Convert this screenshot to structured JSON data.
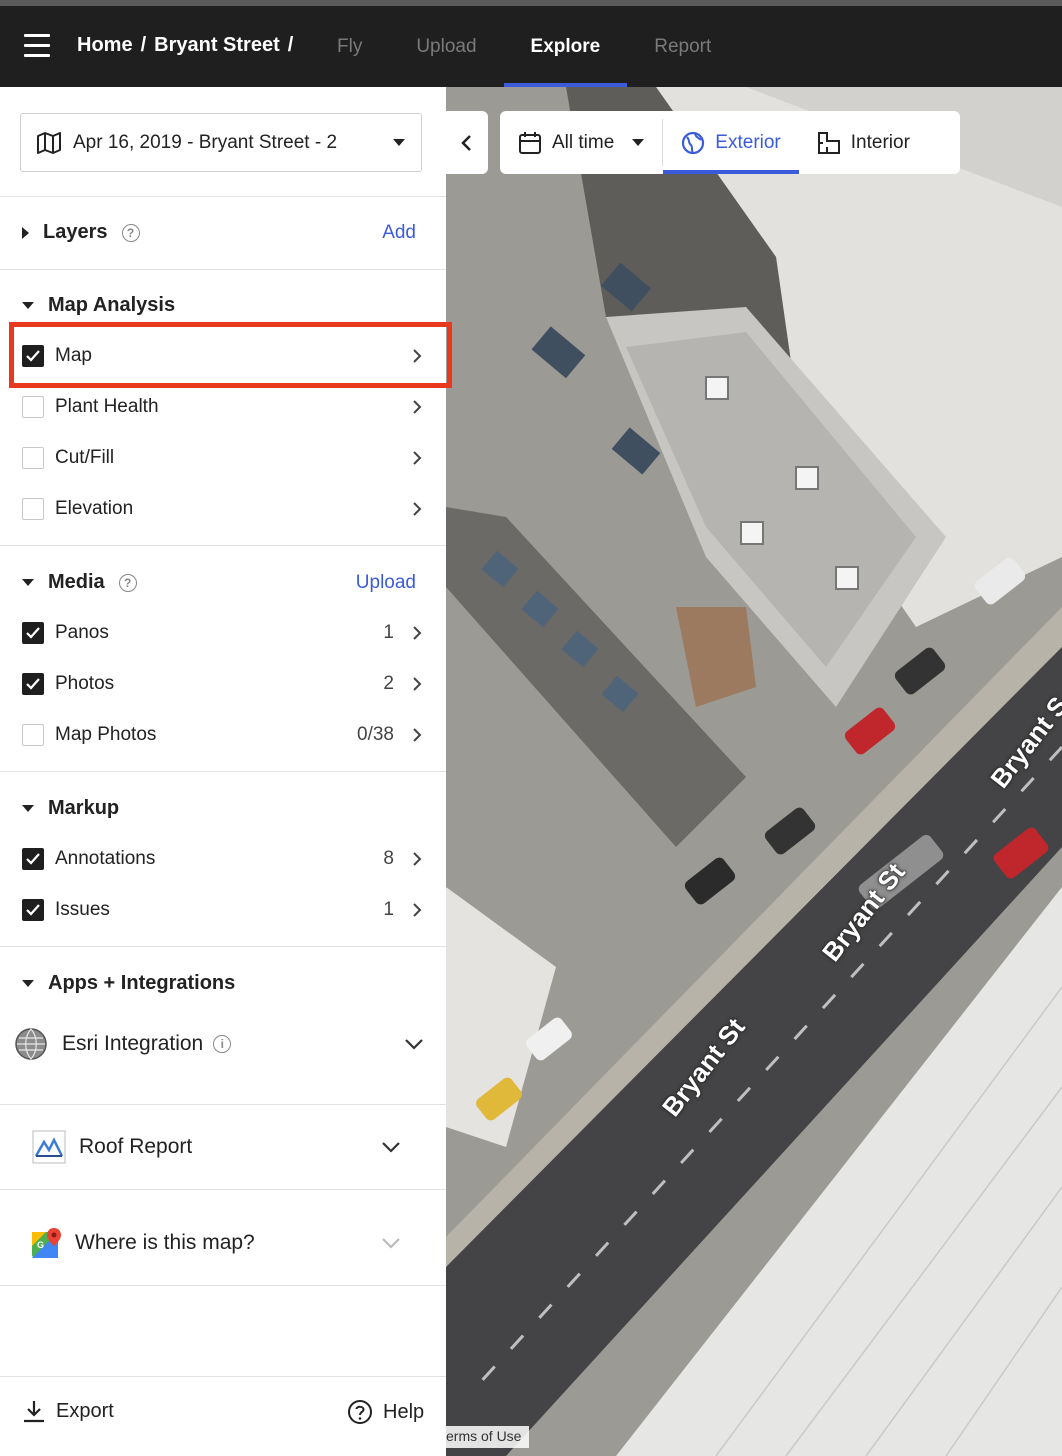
{
  "topbar": {
    "breadcrumb": [
      "Home",
      "/",
      "Bryant Street",
      "/"
    ],
    "tabs": [
      {
        "label": "Fly",
        "active": false
      },
      {
        "label": "Upload",
        "active": false
      },
      {
        "label": "Explore",
        "active": true
      },
      {
        "label": "Report",
        "active": false
      }
    ]
  },
  "sidebar": {
    "dataset": "Apr 16, 2019 - Bryant Street - 2",
    "layers": {
      "title": "Layers",
      "action": "Add"
    },
    "map_analysis": {
      "title": "Map Analysis",
      "items": [
        {
          "label": "Map",
          "checked": true
        },
        {
          "label": "Plant Health",
          "checked": false
        },
        {
          "label": "Cut/Fill",
          "checked": false
        },
        {
          "label": "Elevation",
          "checked": false
        }
      ]
    },
    "media": {
      "title": "Media",
      "action": "Upload",
      "items": [
        {
          "label": "Panos",
          "count": "1",
          "checked": true
        },
        {
          "label": "Photos",
          "count": "2",
          "checked": true
        },
        {
          "label": "Map Photos",
          "count": "0/38",
          "checked": false
        }
      ]
    },
    "markup": {
      "title": "Markup",
      "items": [
        {
          "label": "Annotations",
          "count": "8",
          "checked": true
        },
        {
          "label": "Issues",
          "count": "1",
          "checked": true
        }
      ]
    },
    "apps": {
      "title": "Apps + Integrations",
      "items": [
        {
          "label": "Esri Integration"
        },
        {
          "label": "Roof Report"
        },
        {
          "label": "Where is this map?"
        }
      ]
    },
    "footer": {
      "export": "Export",
      "help": "Help"
    }
  },
  "map_toolbar": {
    "time_filter": "All time",
    "views": [
      {
        "label": "Exterior",
        "active": true
      },
      {
        "label": "Interior",
        "active": false
      }
    ]
  },
  "map": {
    "street_labels": [
      "Bryant St",
      "Bryant St",
      "Bryant S"
    ],
    "terms": "erms of Use"
  },
  "colors": {
    "accent": "#3b5bdb",
    "highlight": "#e8391e",
    "topbar": "#1f1f1f"
  }
}
